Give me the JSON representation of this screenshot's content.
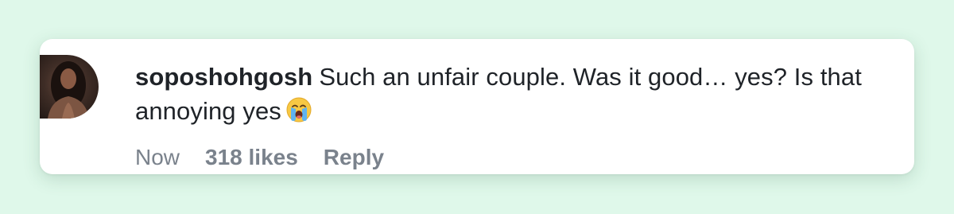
{
  "comment": {
    "username": "soposhohgosh",
    "text": "Such an unfair couple. Was it good… yes? Is that annoying yes",
    "emoji": "crying-face-emoji"
  },
  "meta": {
    "time": "Now",
    "likes": "318 likes",
    "reply_label": "Reply"
  },
  "colors": {
    "background": "#dff8ea",
    "card": "#ffffff",
    "text": "#1f2328",
    "muted": "#7a828c"
  }
}
